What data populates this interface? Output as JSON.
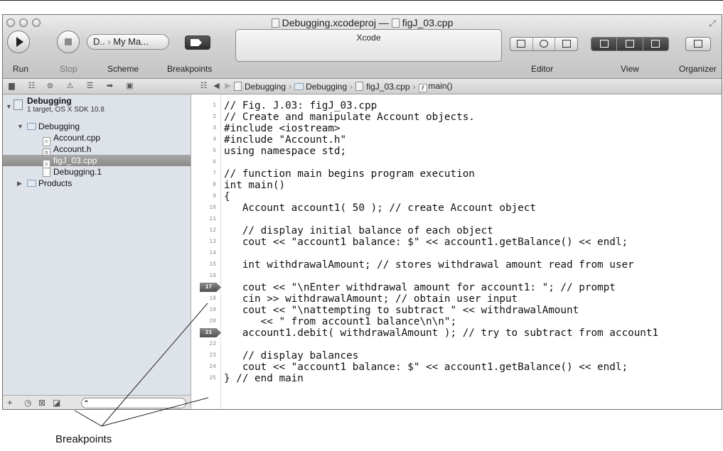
{
  "window": {
    "title": "Debugging.xcodeproj",
    "title_separator": "—",
    "title_file": "figJ_03.cpp",
    "activity_label": "Xcode"
  },
  "toolbar": {
    "run_label": "Run",
    "stop_label": "Stop",
    "scheme_label": "Scheme",
    "scheme_target": "D..",
    "scheme_destination": "My Ma...",
    "breakpoints_label": "Breakpoints",
    "editor_label": "Editor",
    "view_label": "View",
    "organizer_label": "Organizer"
  },
  "breadcrumb": [
    "Debugging",
    "Debugging",
    "figJ_03.cpp",
    "main()"
  ],
  "navigator": {
    "project_name": "Debugging",
    "project_subtitle": "1 target, OS X SDK 10.8",
    "group_name": "Debugging",
    "files": [
      "Account.cpp",
      "Account.h",
      "figJ_03.cpp",
      "Debugging.1"
    ],
    "products_label": "Products",
    "selected_file": "figJ_03.cpp"
  },
  "code": {
    "lines": [
      "// Fig. J.03: figJ_03.cpp",
      "// Create and manipulate Account objects.",
      "#include <iostream>",
      "#include \"Account.h\"",
      "using namespace std;",
      "",
      "// function main begins program execution",
      "int main()",
      "{",
      "   Account account1( 50 ); // create Account object",
      "",
      "   // display initial balance of each object",
      "   cout << \"account1 balance: $\" << account1.getBalance() << endl;",
      "",
      "   int withdrawalAmount; // stores withdrawal amount read from user",
      "",
      "   cout << \"\\nEnter withdrawal amount for account1: \"; // prompt",
      "   cin >> withdrawalAmount; // obtain user input",
      "   cout << \"\\nattempting to subtract \" << withdrawalAmount",
      "      << \" from account1 balance\\n\\n\";",
      "   account1.debit( withdrawalAmount ); // try to subtract from account1",
      "",
      "   // display balances",
      "   cout << \"account1 balance: $\" << account1.getBalance() << endl;",
      "} // end main"
    ],
    "line_numbers": [
      "1",
      "2",
      "3",
      "4",
      "5",
      "6",
      "7",
      "8",
      "9",
      "10",
      "11",
      "12",
      "13",
      "14",
      "15",
      "16",
      "17",
      "18",
      "19",
      "20",
      "21",
      "22",
      "23",
      "24",
      "25"
    ],
    "breakpoint_lines": [
      "17",
      "21"
    ]
  },
  "callout": {
    "label": "Breakpoints"
  }
}
